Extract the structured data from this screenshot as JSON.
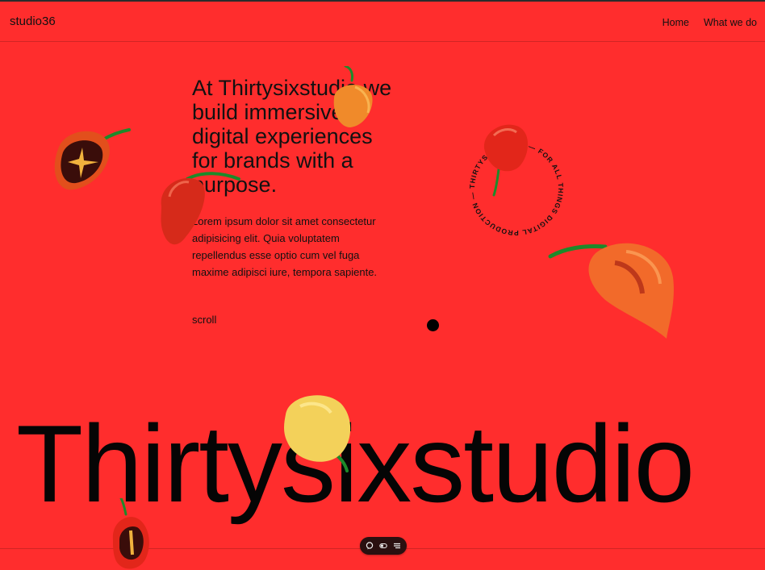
{
  "header": {
    "brand": "studio36",
    "nav": [
      {
        "label": "Home"
      },
      {
        "label": "What we do"
      }
    ]
  },
  "hero": {
    "title": "At Thirtysixstudio we build immersive digital experiences for brands with a purpose.",
    "body": "Lorem ipsum dolor sit amet consectetur adipisicing elit. Quia voluptatem repellendus esse optio cum vel fuga maxime adipisci iure, tempora sapiente.",
    "scroll_label": "scroll"
  },
  "badge": {
    "ring_text": "THIRTYSIXSTUDIO — FOR ALL THINGS DIGITAL PRODUCTION —"
  },
  "big_word": "Thirtysixstudio",
  "toolbar": {
    "icons": [
      "chat-icon",
      "toggle-icon",
      "menu-icon"
    ]
  },
  "colors": {
    "background": "#ff2d2d",
    "text": "#111111"
  }
}
